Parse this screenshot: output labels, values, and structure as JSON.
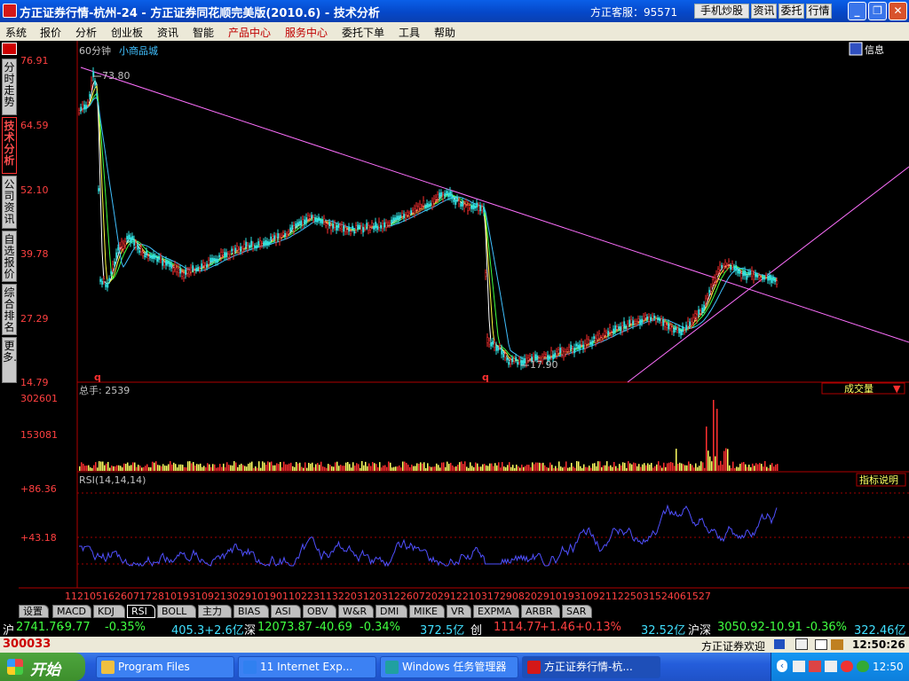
{
  "window": {
    "title": "方正证券行情-杭州-24 - 方正证券同花顺完美版(2010.6) - 技术分析",
    "hotline": "方正客服：95571",
    "buttons": [
      "手机炒股",
      "资讯",
      "委托",
      "行情"
    ]
  },
  "menu": {
    "items": [
      "系统",
      "报价",
      "分析",
      "创业板",
      "资讯",
      "智能",
      "产品中心",
      "服务中心",
      "委托下单",
      "工具",
      "帮助"
    ],
    "highlight": [
      "产品中心",
      "服务中心"
    ]
  },
  "sidebar": {
    "tabs": [
      "分时走势",
      "技术分析",
      "公司资讯",
      "自选报价",
      "综合排名",
      "更多…"
    ],
    "active": "技术分析"
  },
  "main_chart": {
    "period": "60分钟",
    "stock": "小商品城",
    "y_labels": [
      "76.91",
      "64.59",
      "52.10",
      "39.78",
      "27.29",
      "14.79"
    ],
    "high_marker": "73.80",
    "low_marker": "17.90",
    "info_button": "信息",
    "weight_marks": [
      "q",
      "q"
    ]
  },
  "volume_panel": {
    "label": "总手: 2539",
    "y_labels": [
      "302601",
      "153081"
    ],
    "dropdown": "成交量"
  },
  "rsi_panel": {
    "label": "RSI(14,14,14)",
    "y_labels": [
      "+86.36",
      "+43.18"
    ],
    "help": "指标说明"
  },
  "x_axis_labels": "11210516260717281019310921302910190110223113220312031226072029122103172908202910193109211225031524061527",
  "bottom_tabs": {
    "items": [
      "设置",
      "MACD",
      "KDJ",
      "RSI",
      "BOLL",
      "主力",
      "BIAS",
      "ASI",
      "OBV",
      "W&R",
      "DMI",
      "MIKE",
      "VR",
      "EXPMA",
      "ARBR",
      "SAR"
    ],
    "active": "RSI"
  },
  "ticker": {
    "sh_label": "沪",
    "sh_index": "2741.76",
    "sh_change": "-9.77",
    "sh_pct": "-0.35%",
    "sh_amount": "405.3+2.6亿",
    "sz_label": "深",
    "sz_index": "12073.87",
    "sz_change": "-40.69",
    "sz_pct": "-0.34%",
    "sz_amount": "372.5亿",
    "cy_label": "创",
    "cy_index": "1114.77",
    "cy_change": "+1.46+0.13%",
    "cy_amount": "32.52亿",
    "hs_label": "沪深",
    "hs_index": "3050.92",
    "hs_change": "-10.91",
    "hs_pct": "-0.36%",
    "hs_amount": "322.46亿"
  },
  "status": {
    "code": "300033",
    "welcome": "方正证券欢迎",
    "time": "12:50:26"
  },
  "taskbar": {
    "start": "开始",
    "tasks": [
      "Program Files",
      "11 Internet Exp...",
      "Windows 任务管理器",
      "方正证券行情-杭..."
    ],
    "clock": "12:50"
  },
  "colors": {
    "price_axis": "#ff4040",
    "up": "#ff3030",
    "down": "#30e0e0",
    "ma1": "#ffffff",
    "ma2": "#ffff40",
    "ma3": "#40ff40",
    "ma4": "#40c0ff",
    "trendline": "#ff70ff",
    "rsi": "#5050ff",
    "grid": "#a00000"
  }
}
